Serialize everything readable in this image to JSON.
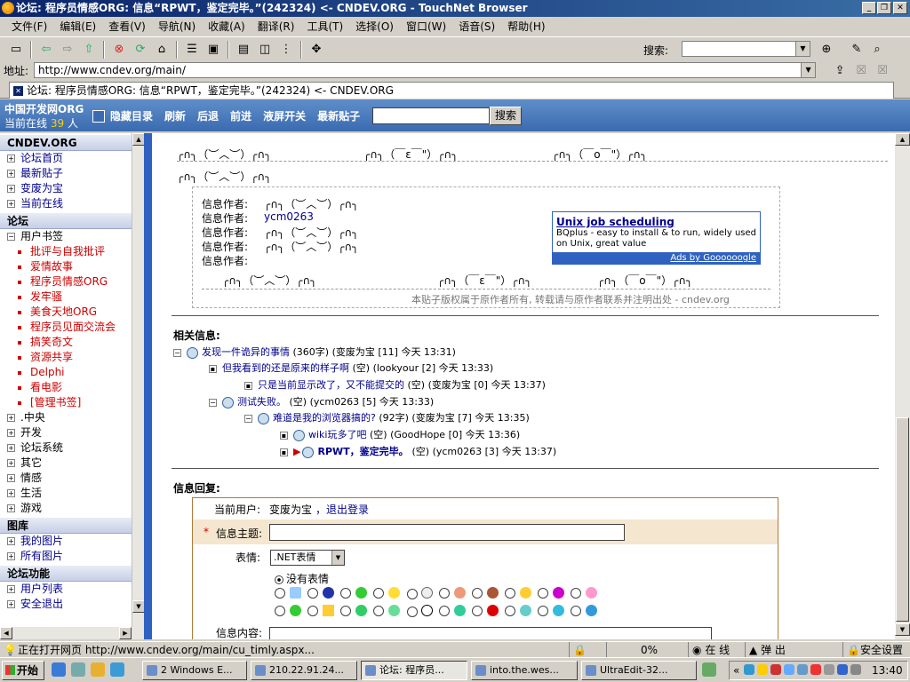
{
  "window": {
    "title": "论坛: 程序员情感ORG: 信息“RPWT，鉴定完毕。”(242324) <- CNDEV.ORG - TouchNet Browser"
  },
  "menu": [
    "文件(F)",
    "编辑(E)",
    "查看(V)",
    "导航(N)",
    "收藏(A)",
    "翻译(R)",
    "工具(T)",
    "选择(O)",
    "窗口(W)",
    "语音(S)",
    "帮助(H)"
  ],
  "toolbar": {
    "search_label": "搜索:",
    "search_value": ""
  },
  "address": {
    "label": "地址:",
    "url": "http://www.cndev.org/main/"
  },
  "tab": {
    "label": "论坛: 程序员情感ORG: 信息“RPWT，鉴定完毕。”(242324) <- CNDEV.ORG"
  },
  "forum_header": {
    "site": "中国开发网ORG",
    "online_label": "当前在线",
    "online_count": "39",
    "online_unit": "人",
    "nav": [
      "隐藏目录",
      "刷新",
      "后退",
      "前进",
      "液屏开关",
      "最新贴子"
    ],
    "search_button": "搜索"
  },
  "sidebar": {
    "section1": "CNDEV.ORG",
    "items1": [
      "论坛首页",
      "最新贴子",
      "变废为宝",
      "当前在线"
    ],
    "section2": "论坛",
    "group_label": "用户书签",
    "bookmarks": [
      "批评与自我批评",
      "爱情故事",
      "程序员情感ORG",
      "发牢骚",
      "美食天地ORG",
      "程序员见面交流会",
      "搞笑奇文",
      "资源共享",
      "Delphi",
      "看电影",
      "[管理书签]"
    ],
    "groups": [
      ".中央",
      "开发",
      "论坛系统",
      "其它",
      "情感",
      "生活",
      "游戏"
    ],
    "section3": "图库",
    "items3": [
      "我的图片",
      "所有图片"
    ],
    "section4": "论坛功能",
    "items4": [
      "用户列表",
      "安全退出"
    ]
  },
  "post": {
    "emote1": "╭∩╮（︶︿︶）╭∩╮",
    "emote2": "╭∩╮（￣ε￣\"）╭∩╮",
    "emote3": "╭∩╮（￣ο￣\"）╭∩╮",
    "emote4": "╭∩╮（︶︿︶）╭∩╮",
    "info_labels": [
      "信息作者:",
      "信息作者:",
      "信息作者:",
      "信息作者:",
      "信息作者:"
    ],
    "info_values": [
      "╭∩╮（︶︿︶）╭∩╮",
      "ycm0263",
      "╭∩╮（︶︿︶）╭∩╮",
      "╭∩╮（︶︿︶）╭∩╮",
      ""
    ],
    "emote5": "╭∩╮（︶︿︶）╭∩╮",
    "emote6": "╭∩╮（￣ε￣\"）╭∩╮",
    "emote7": "╭∩╮（￣ο￣\"）╭∩╮",
    "copyright": "本贴子版权属于原作者所有, 转载请与原作者联系并注明出处 - cndev.org"
  },
  "ad": {
    "title": "Unix job scheduling",
    "desc": "BQplus - easy to install & to run, widely used on Unix, great value",
    "footer": "Ads by Goooooogle"
  },
  "related": {
    "title": "相关信息:",
    "threads": [
      {
        "title": "发现一件诡异的事情",
        "meta": "(360字) (变废为宝 [11] 今天 13:31)"
      },
      {
        "title": "但我看到的还是原来的样子啊",
        "meta": "(空) (lookyour [2] 今天 13:33)"
      },
      {
        "title": "只是当前显示改了，又不能提交的",
        "meta": "(空) (变废为宝 [0] 今天 13:37)"
      },
      {
        "title": "测试失败。",
        "meta": "(空) (ycm0263 [5] 今天 13:33)"
      },
      {
        "title": "难道是我的浏览器搞的?",
        "meta": "(92字) (变废为宝 [7] 今天 13:35)"
      },
      {
        "title": "wiki玩多了吧",
        "meta": "(空) (GoodHope [0] 今天 13:36)"
      },
      {
        "title": "RPWT，鉴定完毕。",
        "meta": "(空) (ycm0263 [3] 今天 13:37)"
      }
    ]
  },
  "reply": {
    "title": "信息回复:",
    "user_label": "当前用户:",
    "user": "变废为宝",
    "logout": "，退出登录",
    "subject_star": "*",
    "subject_label": "信息主题:",
    "emote_label": "表情:",
    "emote_select": ".NET表情",
    "no_emote": "没有表情",
    "content_label": "信息内容:"
  },
  "status": {
    "text": "正在打开网页 http://www.cndev.org/main/cu_timly.aspx...",
    "progress": "0%",
    "online": "在 线",
    "popup": "弹 出",
    "security": "安全设置"
  },
  "taskbar": {
    "start": "开始",
    "tasks": [
      "2 Windows E...",
      "210.22.91.24...",
      "论坛: 程序员...",
      "into.the.wes...",
      "UltraEdit-32..."
    ],
    "clock": "13:40"
  }
}
